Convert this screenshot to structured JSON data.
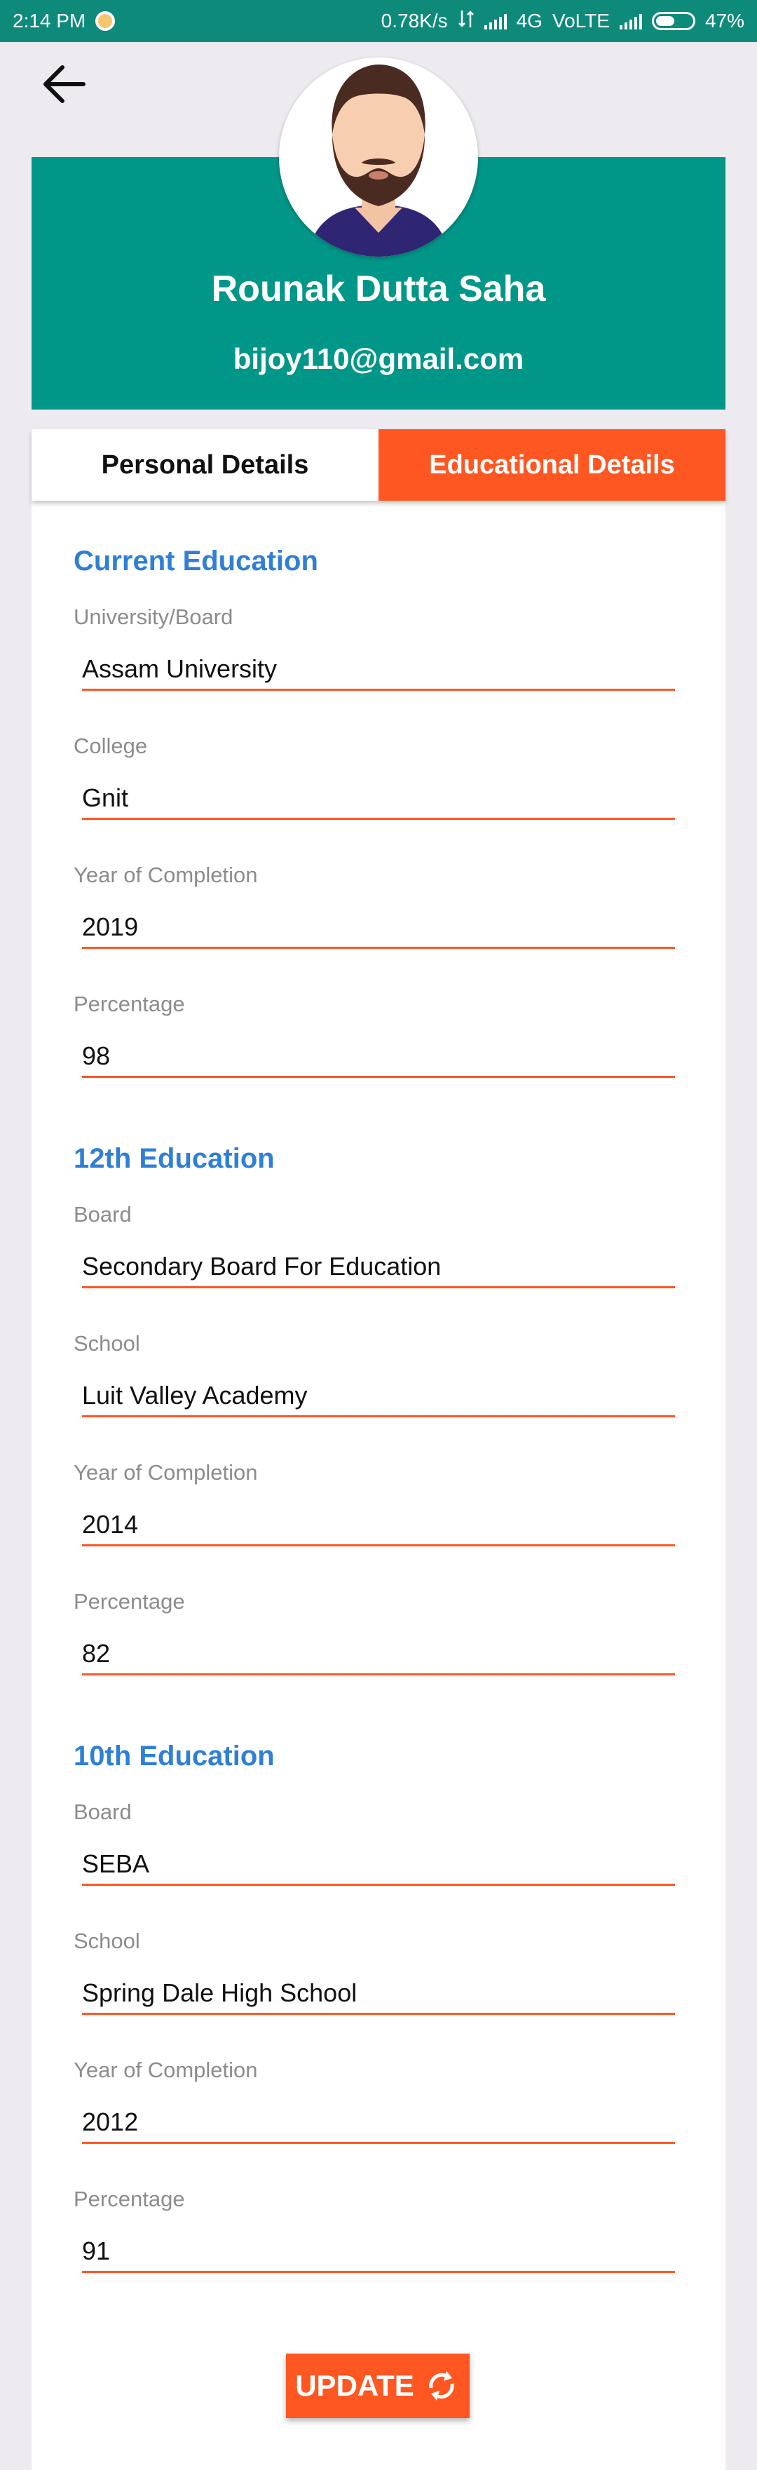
{
  "status_bar": {
    "time": "2:14 PM",
    "speed": "0.78K/s",
    "network": "4G",
    "volte": "VoLTE",
    "battery": "47%"
  },
  "profile": {
    "name": "Rounak Dutta Saha",
    "email": "bijoy110@gmail.com"
  },
  "tabs": {
    "personal": "Personal Details",
    "educational": "Educational Details",
    "active": "educational"
  },
  "sections": [
    {
      "title": "Current Education",
      "fields": [
        {
          "label": "University/Board",
          "value": "Assam University"
        },
        {
          "label": "College",
          "value": "Gnit"
        },
        {
          "label": "Year of Completion",
          "value": "2019"
        },
        {
          "label": "Percentage",
          "value": "98"
        }
      ]
    },
    {
      "title": "12th Education",
      "fields": [
        {
          "label": "Board",
          "value": "Secondary Board For Education"
        },
        {
          "label": "School",
          "value": "Luit Valley Academy"
        },
        {
          "label": "Year of Completion",
          "value": "2014"
        },
        {
          "label": "Percentage",
          "value": "82"
        }
      ]
    },
    {
      "title": "10th Education",
      "fields": [
        {
          "label": "Board",
          "value": "SEBA"
        },
        {
          "label": "School",
          "value": "Spring Dale High School"
        },
        {
          "label": "Year of Completion",
          "value": "2012"
        },
        {
          "label": "Percentage",
          "value": "91"
        }
      ]
    }
  ],
  "update_button": {
    "label": "UPDATE",
    "icon": "refresh-icon"
  },
  "colors": {
    "status_bar": "#0d8a7a",
    "header": "#009688",
    "accent": "#ff5722",
    "section_title": "#2f7fd6",
    "background": "#edebef"
  }
}
